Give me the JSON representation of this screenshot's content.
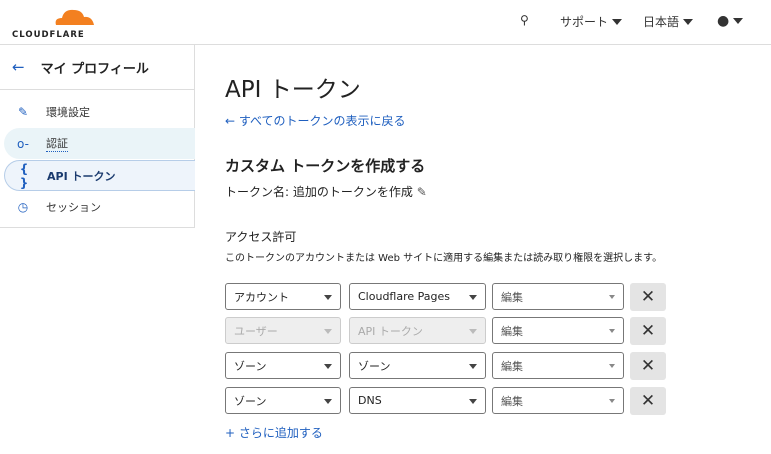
{
  "header": {
    "brand": "CLOUDFLARE",
    "support": "サポート",
    "language": "日本語"
  },
  "sidebar": {
    "title": "マイ プロフィール",
    "items": [
      {
        "label": "環境設定"
      },
      {
        "label": "認証"
      },
      {
        "label": "API トークン"
      },
      {
        "label": "セッション"
      }
    ]
  },
  "main": {
    "title": "API トークン",
    "back_link": "← すべてのトークンの表示に戻る",
    "section_title": "カスタム トークンを作成する",
    "token_name": "トークン名: 追加のトークンを作成",
    "access_label": "アクセス許可",
    "access_desc": "このトークンのアカウントまたは Web サイトに適用する編集または読み取り権限を選択します。",
    "rows": [
      {
        "scope": "アカウント",
        "resource": "Cloudflare Pages",
        "permission": "編集"
      },
      {
        "scope": "ユーザー",
        "resource": "API トークン",
        "permission": "編集"
      },
      {
        "scope": "ゾーン",
        "resource": "ゾーン",
        "permission": "編集"
      },
      {
        "scope": "ゾーン",
        "resource": "DNS",
        "permission": "編集"
      }
    ],
    "add_more": "+ さらに追加する"
  }
}
